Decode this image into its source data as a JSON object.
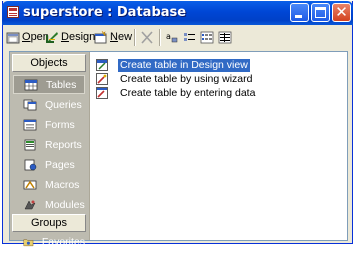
{
  "window": {
    "title": "superstore : Database",
    "colors": {
      "titlebar": "#0046d5",
      "close": "#d3411f",
      "selection": "#316ac5"
    }
  },
  "toolbar": {
    "open_label": "Open",
    "design_label": "Design",
    "new_label": "New",
    "icons": [
      "open-icon",
      "design-icon",
      "new-icon",
      "delete-icon",
      "large-icons-icon",
      "small-icons-icon",
      "list-icon",
      "details-icon"
    ]
  },
  "sidebar": {
    "objects_header": "Objects",
    "groups_header": "Groups",
    "items": [
      {
        "label": "Tables",
        "icon": "table-icon",
        "selected": true
      },
      {
        "label": "Queries",
        "icon": "query-icon"
      },
      {
        "label": "Forms",
        "icon": "form-icon"
      },
      {
        "label": "Reports",
        "icon": "report-icon"
      },
      {
        "label": "Pages",
        "icon": "page-icon"
      },
      {
        "label": "Macros",
        "icon": "macro-icon"
      },
      {
        "label": "Modules",
        "icon": "module-icon"
      }
    ],
    "groups": [
      {
        "label": "Favorites",
        "icon": "favorites-folder-icon"
      }
    ]
  },
  "list": {
    "items": [
      {
        "label": "Create table in Design view",
        "icon": "design-view-icon",
        "selected": true
      },
      {
        "label": "Create table by using wizard",
        "icon": "wizard-icon"
      },
      {
        "label": "Create table by entering data",
        "icon": "datasheet-icon"
      }
    ]
  }
}
